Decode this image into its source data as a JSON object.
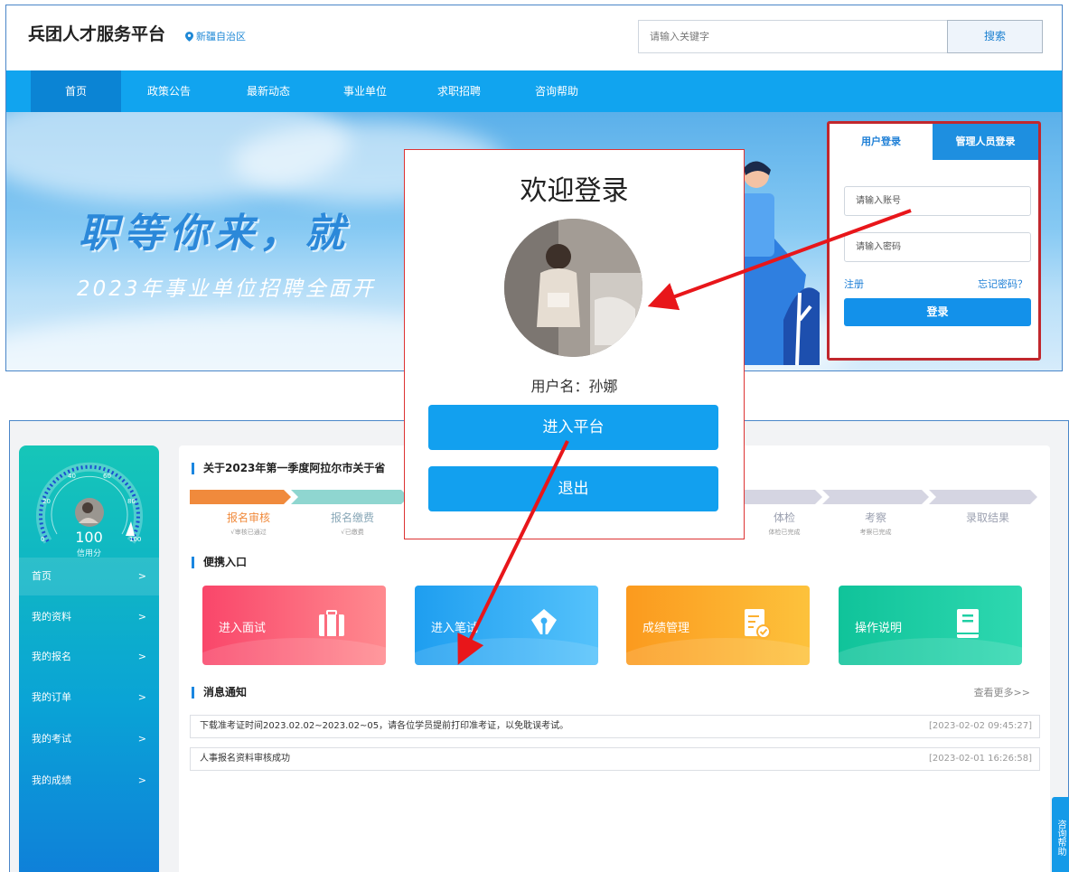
{
  "header": {
    "site_title": "兵团人才服务平台",
    "region": "新疆自治区",
    "search_placeholder": "请输入关键字",
    "search_button": "搜索"
  },
  "nav": {
    "items": [
      "首页",
      "政策公告",
      "最新动态",
      "事业单位",
      "求职招聘",
      "咨询帮助"
    ],
    "active_index": 0
  },
  "banner": {
    "headline": "职等你来，就",
    "subline": "2023年事业单位招聘全面开"
  },
  "login_panel": {
    "tab_user": "用户登录",
    "tab_admin": "管理人员登录",
    "account_placeholder": "请输入账号",
    "password_placeholder": "请输入密码",
    "register": "注册",
    "forgot": "忘记密码？",
    "submit": "登录"
  },
  "popup": {
    "title": "欢迎登录",
    "username": "用户名：孙娜",
    "enter_button": "进入平台",
    "logout_button": "退出"
  },
  "sidebar": {
    "gauge_ticks": [
      "0",
      "20",
      "40",
      "60",
      "80",
      "100"
    ],
    "credit_value": "100",
    "credit_label": "信用分",
    "items": [
      {
        "label": "首页",
        "chevron": ">"
      },
      {
        "label": "我的资料",
        "chevron": ">"
      },
      {
        "label": "我的报名",
        "chevron": ">"
      },
      {
        "label": "我的订单",
        "chevron": ">"
      },
      {
        "label": "我的考试",
        "chevron": ">"
      },
      {
        "label": "我的成绩",
        "chevron": ">"
      }
    ]
  },
  "announcement": {
    "title": "关于2023年第一季度阿拉尔市关于省"
  },
  "progress": {
    "steps": [
      {
        "name": "报名审核",
        "sub": "√审核已通过",
        "color": "#f08a3c"
      },
      {
        "name": "报名缴费",
        "sub": "√已缴费",
        "color": "#8fd6d0"
      },
      {
        "name": "体检",
        "sub": "体检已完成",
        "color": "#d5d5e2"
      },
      {
        "name": "考察",
        "sub": "考察已完成",
        "color": "#d5d5e2"
      },
      {
        "name": "录取结果",
        "sub": "",
        "color": "#d5d5e2"
      }
    ]
  },
  "quick_entry": {
    "title": "便携入口",
    "cards": [
      {
        "label": "进入面试",
        "icon": "briefcase-icon",
        "color_from": "#f9466a",
        "color_to": "#ff8a8f"
      },
      {
        "label": "进入笔试",
        "icon": "pen-nib-icon",
        "color_from": "#1e9ef0",
        "color_to": "#55c2fb"
      },
      {
        "label": "成绩管理",
        "icon": "document-check-icon",
        "color_from": "#fb9a1e",
        "color_to": "#fdc23c"
      },
      {
        "label": "操作说明",
        "icon": "book-icon",
        "color_from": "#10c39a",
        "color_to": "#2ed8b0"
      }
    ]
  },
  "news": {
    "title": "消息通知",
    "more": "查看更多>>",
    "items": [
      {
        "text": "下载准考证时间2023.02.02~2023.02~05，请各位学员提前打印准考证，以免耽误考试。",
        "date": "[2023-02-02 09:45:27]"
      },
      {
        "text": "人事报名资料审核成功",
        "date": "[2023-02-01 16:26:58]"
      }
    ]
  },
  "help_tab": "咨询帮助",
  "colors": {
    "nav_bg": "#11a4ef",
    "accent": "#1e8fe0",
    "highlight_red": "#c1272d",
    "annotation_arrow": "#e8161a"
  }
}
